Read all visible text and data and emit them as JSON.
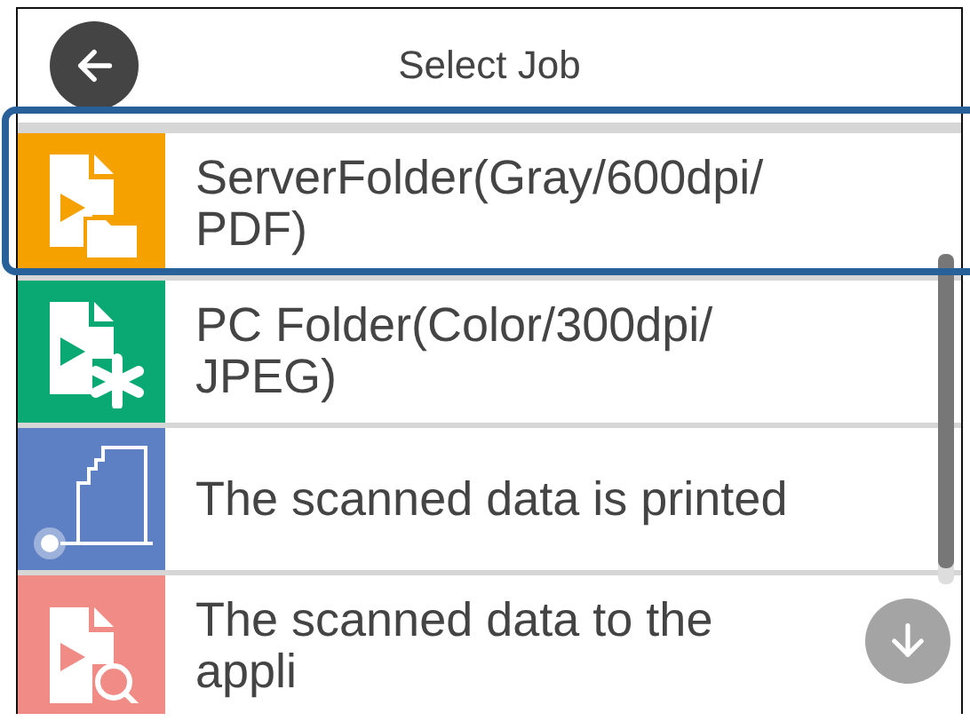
{
  "header": {
    "title": "Select Job"
  },
  "jobs": [
    {
      "label": "ServerFolder(Gray/600dpi/PDF)",
      "kind": "server-folder",
      "color": "#f5a100",
      "highlighted": true
    },
    {
      "label": "PC Folder(Color/300dpi/JPEG)",
      "kind": "pc-folder",
      "color": "#0aa973",
      "highlighted": false
    },
    {
      "label": "The scanned data is printed",
      "kind": "print",
      "color": "#5d7fc3",
      "highlighted": false
    },
    {
      "label": "The scanned data to the appli",
      "kind": "app",
      "color": "#f08c85",
      "highlighted": false
    }
  ]
}
